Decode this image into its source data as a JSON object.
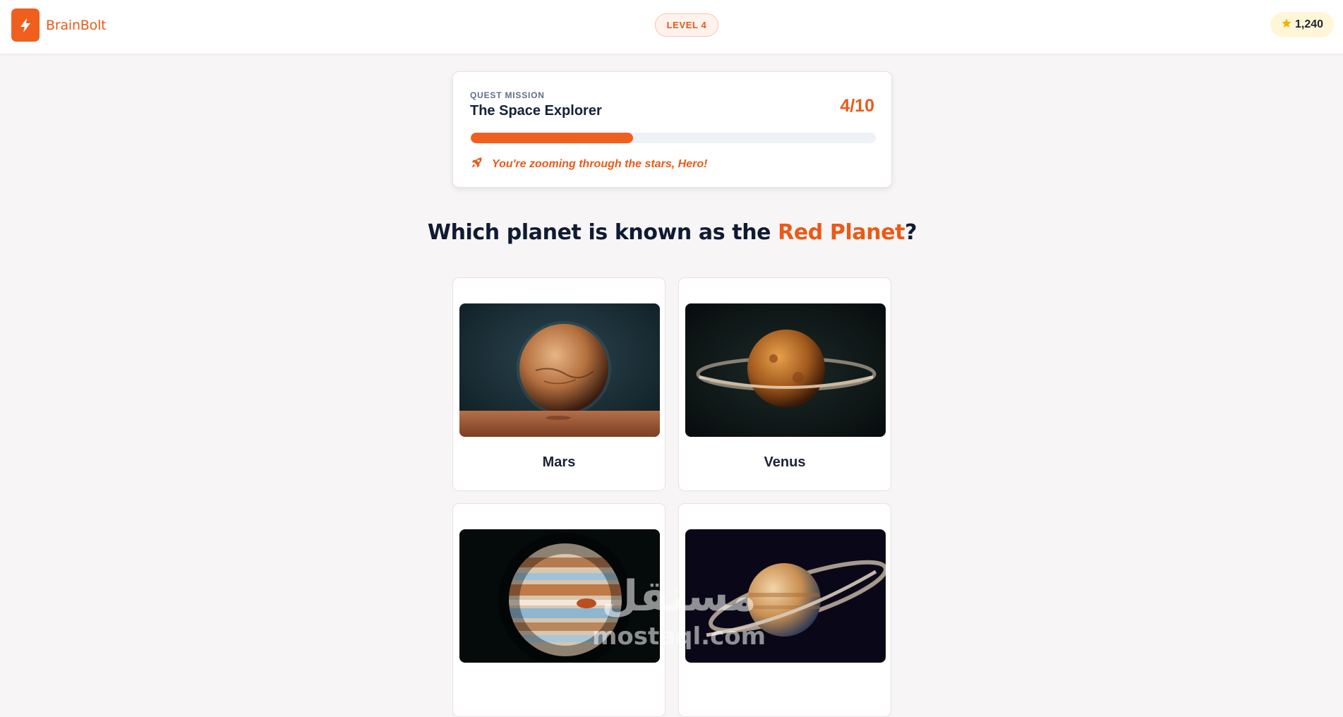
{
  "header": {
    "app_name": "BrainBolt",
    "level_label": "LEVEL 4",
    "points": "1,240"
  },
  "quest": {
    "label": "QUEST MISSION",
    "title": "The Space Explorer",
    "progress_text": "4/10",
    "progress_fraction": 0.4,
    "message": "You're zooming through the stars, Hero!"
  },
  "question": {
    "prefix": "Which planet is known as the ",
    "highlight": "Red Planet",
    "suffix": "?"
  },
  "options": [
    {
      "label": "Mars",
      "image": "mars"
    },
    {
      "label": "Venus",
      "image": "venus"
    },
    {
      "label": "",
      "image": "jupiter"
    },
    {
      "label": "",
      "image": "saturn"
    }
  ],
  "colors": {
    "accent": "#f15f1f",
    "accent_text": "#ea5a18",
    "star": "#f2b300",
    "page_bg": "#f7f5f5"
  },
  "watermark": {
    "brand": "mostaql.com"
  }
}
